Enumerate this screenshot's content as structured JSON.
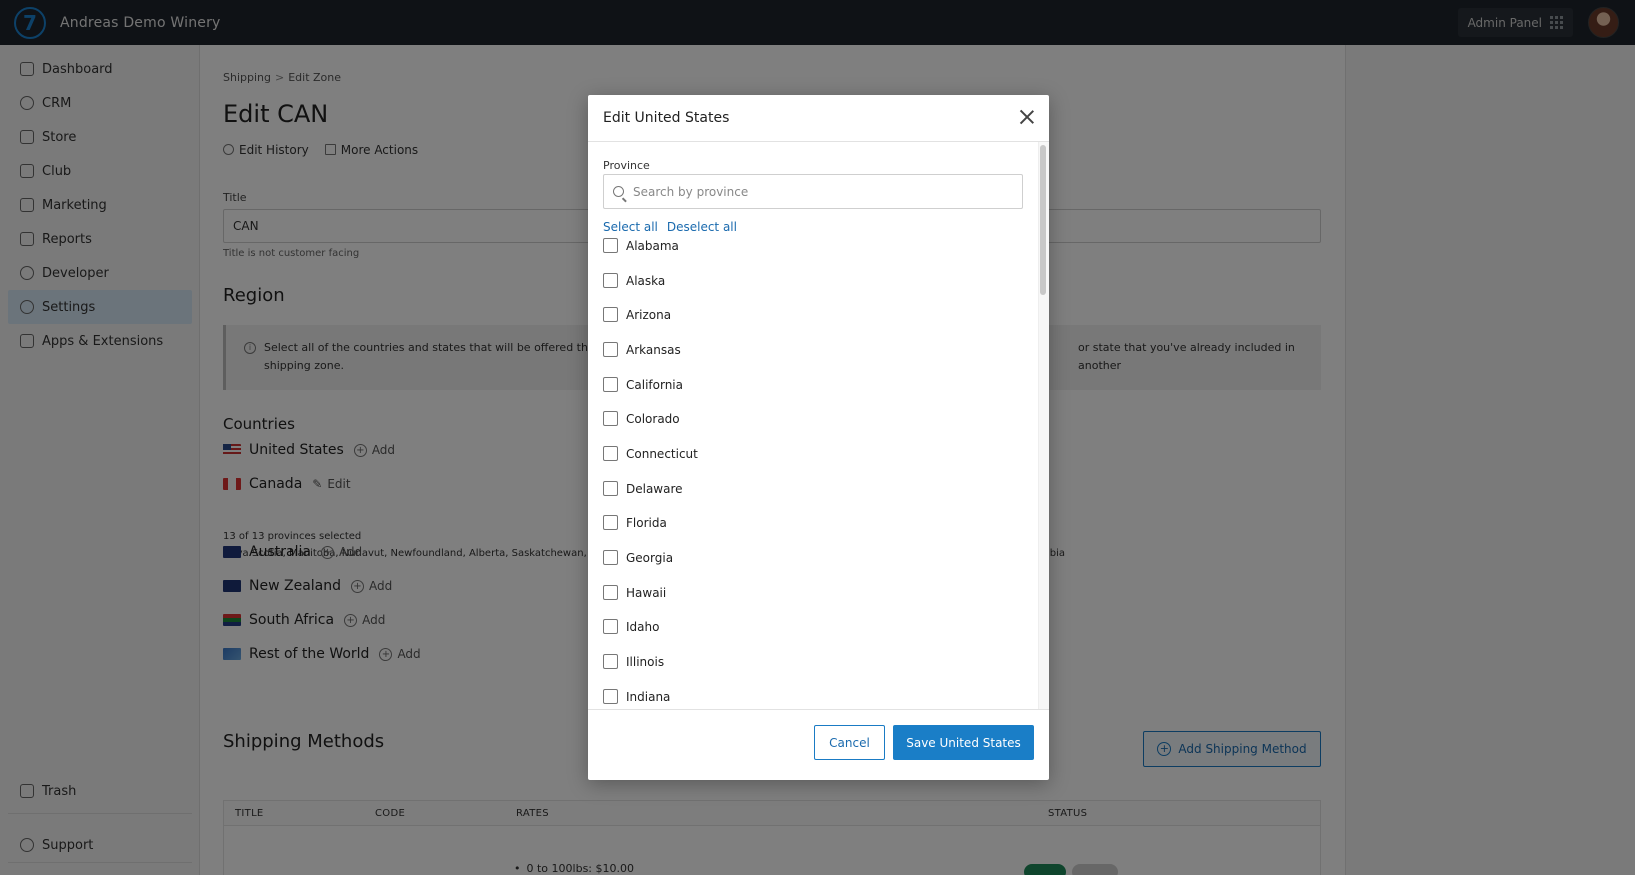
{
  "app": {
    "title": "Andreas Demo Winery",
    "logo_char": "7",
    "admin_panel_label": "Admin Panel"
  },
  "sidebar": {
    "items": [
      {
        "label": "Dashboard",
        "icon": "home-icon"
      },
      {
        "label": "CRM",
        "icon": "crm-icon"
      },
      {
        "label": "Store",
        "icon": "store-icon"
      },
      {
        "label": "Club",
        "icon": "diamond-icon"
      },
      {
        "label": "Marketing",
        "icon": "megaphone-icon"
      },
      {
        "label": "Reports",
        "icon": "bar-chart-icon"
      },
      {
        "label": "Developer",
        "icon": "developer-icon"
      },
      {
        "label": "Settings",
        "icon": "gear-icon",
        "active": true
      },
      {
        "label": "Apps & Extensions",
        "icon": "flask-icon"
      }
    ],
    "trash_label": "Trash",
    "support_label": "Support"
  },
  "page": {
    "breadcrumb_parent": "Shipping",
    "breadcrumb_sep": ">",
    "breadcrumb_current": "Edit Zone",
    "title": "Edit CAN",
    "edit_history": "Edit History",
    "more_actions": "More Actions",
    "title_label": "Title",
    "title_value": "CAN",
    "title_hint": "Title is not customer facing",
    "region_heading": "Region",
    "info_text_left": "Select all of the countries and states that will be offered the sa",
    "info_text_right": "or state that you've already included in another",
    "info_text_line2": "shipping zone.",
    "countries_heading": "Countries",
    "countries": [
      {
        "name": "United States",
        "action": "Add"
      },
      {
        "name": "Canada",
        "action": "Edit"
      },
      {
        "name": "Australia",
        "action": "Add"
      },
      {
        "name": "New Zealand",
        "action": "Add"
      },
      {
        "name": "South Africa",
        "action": "Add"
      },
      {
        "name": "Rest of the World",
        "action": "Add"
      }
    ],
    "canada_selected": "13 of 13 provinces selected",
    "canada_list_left": "Nova Scotia, Manitoba, Nunavut, Newfoundland, Alberta, Saskatchewan, Pr",
    "canada_list_right": "mbia",
    "shipping_methods_heading": "Shipping Methods",
    "add_shipping_method": "Add Shipping Method",
    "table_columns": [
      "TITLE",
      "CODE",
      "RATES",
      "STATUS"
    ],
    "rate_line": "0 to 100lbs: $10.00"
  },
  "modal": {
    "title": "Edit United States",
    "province_label": "Province",
    "search_placeholder": "Search by province",
    "select_all": "Select all",
    "deselect_all": "Deselect all",
    "provinces": [
      "Alabama",
      "Alaska",
      "Arizona",
      "Arkansas",
      "California",
      "Colorado",
      "Connecticut",
      "Delaware",
      "Florida",
      "Georgia",
      "Hawaii",
      "Idaho",
      "Illinois",
      "Indiana"
    ],
    "cancel_label": "Cancel",
    "save_label": "Save United States"
  }
}
